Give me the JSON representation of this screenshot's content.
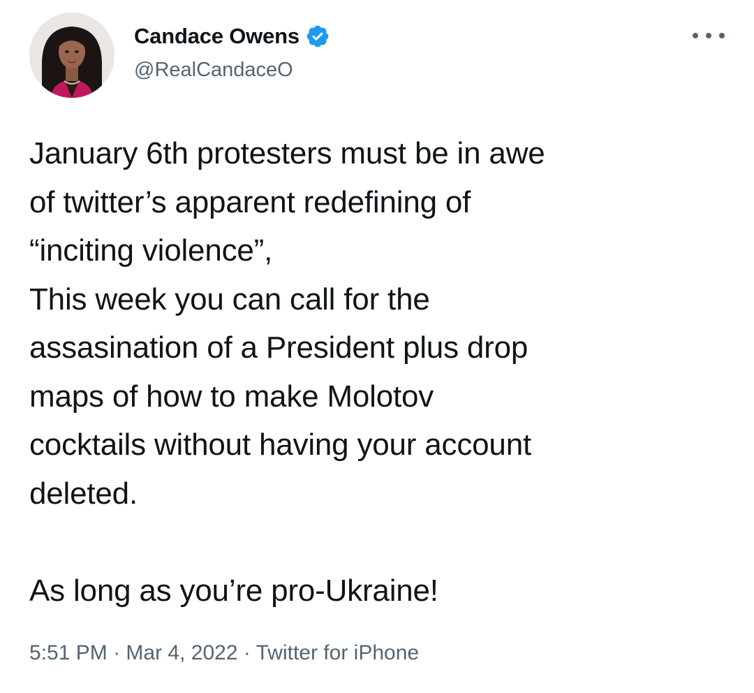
{
  "author": {
    "display_name": "Candace Owens",
    "handle": "@RealCandaceO",
    "verified": true,
    "avatar_icon": "profile-photo"
  },
  "tweet": {
    "lines": [
      "January 6th protesters must be in awe",
      "of twitter’s apparent redefining of",
      "“inciting violence”,",
      "This week you can call for the",
      "assasination of a President plus drop",
      "maps of how to make Molotov",
      "cocktails without having your account",
      "deleted.",
      "",
      "As long as you’re pro-Ukraine!"
    ]
  },
  "meta": {
    "time": "5:51 PM",
    "date": "Mar 4, 2022",
    "source": "Twitter for iPhone",
    "separator": " · "
  },
  "colors": {
    "text": "#0f1419",
    "secondary": "#536471",
    "verified": "#1d9bf0"
  },
  "icons": {
    "more": "more-horizontal-icon",
    "verified": "verified-badge-icon"
  }
}
